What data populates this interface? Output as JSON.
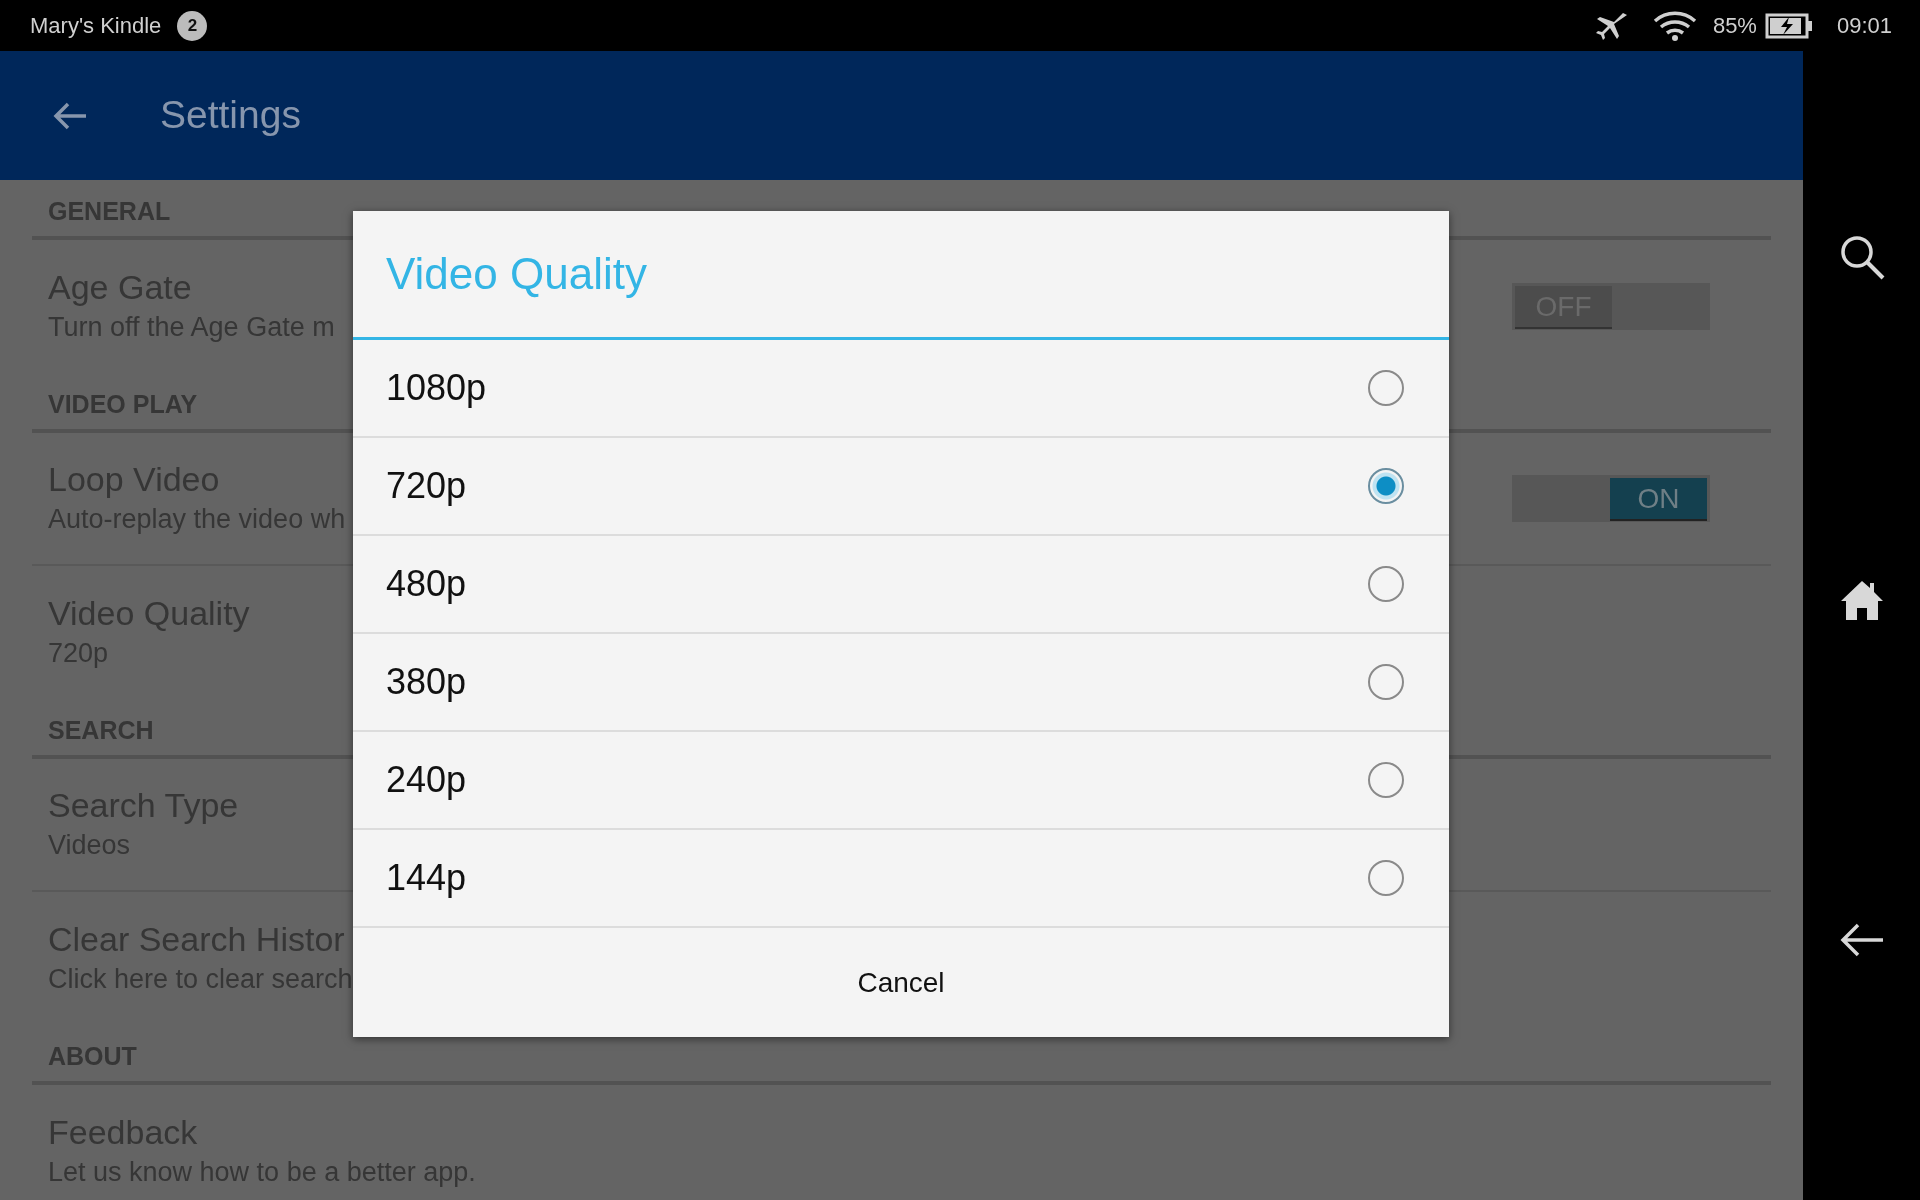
{
  "status_bar": {
    "device_name": "Mary's Kindle",
    "notification_count": "2",
    "battery": "85%",
    "time": "09:01"
  },
  "app_bar": {
    "title": "Settings"
  },
  "settings": [
    {
      "header": "GENERAL",
      "items": [
        {
          "kind": "toggle",
          "title": "Age Gate",
          "subtitle": "Turn off the Age Gate m",
          "on": false,
          "toggle_label": "OFF"
        }
      ]
    },
    {
      "header": "VIDEO PLAY",
      "items": [
        {
          "kind": "toggle",
          "title": "Loop Video",
          "subtitle": "Auto-replay the video wh",
          "on": true,
          "toggle_label": "ON"
        },
        {
          "kind": "plain",
          "title": "Video Quality",
          "subtitle": "720p"
        }
      ]
    },
    {
      "header": "SEARCH",
      "items": [
        {
          "kind": "plain",
          "title": "Search Type",
          "subtitle": "Videos"
        },
        {
          "kind": "plain",
          "title": "Clear Search Histor",
          "subtitle": "Click here to clear search"
        }
      ]
    },
    {
      "header": "ABOUT",
      "items": [
        {
          "kind": "plain",
          "title": "Feedback",
          "subtitle": "Let us know how to be a better app."
        }
      ]
    }
  ],
  "dialog": {
    "title": "Video Quality",
    "options": [
      {
        "label": "1080p",
        "selected": false
      },
      {
        "label": "720p",
        "selected": true
      },
      {
        "label": "480p",
        "selected": false
      },
      {
        "label": "380p",
        "selected": false
      },
      {
        "label": "240p",
        "selected": false
      },
      {
        "label": "144p",
        "selected": false
      }
    ],
    "cancel": "Cancel"
  }
}
